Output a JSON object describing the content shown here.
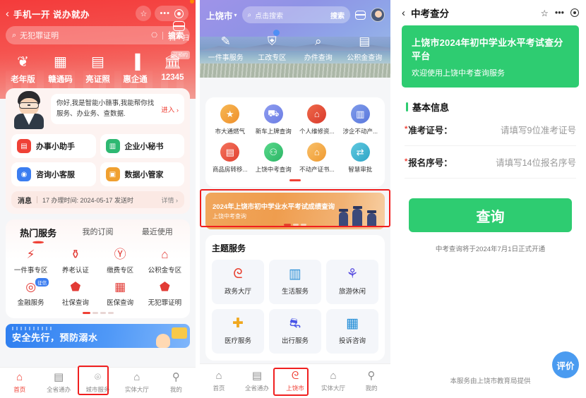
{
  "panel1": {
    "header": {
      "back_icon": "back-chevron-icon",
      "title": "手机一开 说办就办",
      "star_icon": "star-icon",
      "more_icon": "more-dots-icon",
      "target_icon": "target-icon",
      "scan_label": "扫一扫",
      "scan_icon": "scan-icon"
    },
    "search": {
      "icon": "search-icon",
      "placeholder": "无犯罪证明",
      "mic_icon": "microphone-icon",
      "button_label": "搜索"
    },
    "quick_items": [
      {
        "label": "老年版",
        "icon": "elder-heart-icon",
        "glyph": "♡",
        "badge": ""
      },
      {
        "label": "赣通码",
        "icon": "qr-grid-icon",
        "glyph": "▦",
        "badge": ""
      },
      {
        "label": "亮证照",
        "icon": "id-card-icon",
        "glyph": "▤",
        "badge": ""
      },
      {
        "label": "惠企通",
        "icon": "building-icon",
        "glyph": "🏢",
        "badge": ""
      },
      {
        "label": "12345",
        "icon": "bank-columns-icon",
        "glyph": "🏛",
        "badge": "可预约"
      }
    ],
    "assistant": {
      "avatar_icon": "assistant-avatar",
      "message": "你好,我是智能小赣事,我能帮你找服务、办业务、查数据.",
      "enter_label": "进入 ›",
      "items": [
        {
          "label": "办事小助手",
          "icon": "helper-icon",
          "color": "#ef4136",
          "glyph": "▤"
        },
        {
          "label": "企业小秘书",
          "icon": "enterprise-secretary-icon",
          "color": "#2eb872",
          "glyph": "▥"
        },
        {
          "label": "咨询小客服",
          "icon": "consult-service-icon",
          "color": "#3b7df0",
          "glyph": "◉"
        },
        {
          "label": "数据小管家",
          "icon": "data-steward-icon",
          "color": "#f0a030",
          "glyph": "▣"
        }
      ]
    },
    "message_bar": {
      "title": "消息",
      "content": "17 办理时间: 2024-05-17 发送时",
      "detail_label": "详情 ›"
    },
    "hot_card": {
      "tabs": [
        {
          "label": "热门服务",
          "active": true
        },
        {
          "label": "我的订阅",
          "active": false
        },
        {
          "label": "最近使用",
          "active": false
        }
      ],
      "items": [
        {
          "label": "一件事专区",
          "icon": "lightning-circle-icon",
          "glyph": "⚡",
          "badge": ""
        },
        {
          "label": "养老认证",
          "icon": "elder-person-icon",
          "glyph": "👤",
          "badge": ""
        },
        {
          "label": "缴费专区",
          "icon": "yuan-circle-icon",
          "glyph": "¥",
          "badge": ""
        },
        {
          "label": "公积金专区",
          "icon": "fund-house-icon",
          "glyph": "⌂",
          "badge": ""
        },
        {
          "label": "金融服务",
          "icon": "finance-circle-icon",
          "glyph": "◎",
          "badge": "征信"
        },
        {
          "label": "社保查询",
          "icon": "social-insurance-icon",
          "glyph": "SI",
          "badge": ""
        },
        {
          "label": "医保查询",
          "icon": "medical-insurance-icon",
          "glyph": "+",
          "badge": ""
        },
        {
          "label": "无犯罪证明",
          "icon": "no-crime-shield-icon",
          "glyph": "★",
          "badge": ""
        }
      ],
      "page_dots": 4,
      "active_dot": 0
    },
    "blue_banner": {
      "title": "安全先行，预防溺水"
    },
    "tabbar": [
      {
        "label": "首页",
        "icon": "home-icon",
        "glyph": "⌂",
        "active": true
      },
      {
        "label": "全省通办",
        "icon": "document-icon",
        "glyph": "▤",
        "active": false
      },
      {
        "label": "城市服务",
        "icon": "location-pin-icon",
        "glyph": "⌾",
        "active": false,
        "highlighted": true
      },
      {
        "label": "实体大厅",
        "icon": "hall-building-icon",
        "glyph": "⌂",
        "active": false
      },
      {
        "label": "我的",
        "icon": "person-icon",
        "glyph": "⚲",
        "active": false
      }
    ]
  },
  "panel2": {
    "header": {
      "city": "上饶市",
      "chevron_icon": "chevron-down-icon",
      "search_icon": "search-icon",
      "search_placeholder": "点击搜索",
      "search_button": "搜索",
      "scan_icon": "scan-icon",
      "avatar_icon": "user-avatar"
    },
    "quick_items": [
      {
        "label": "一件事服务",
        "icon": "pen-document-icon",
        "glyph": "✎",
        "dot": false
      },
      {
        "label": "工改专区",
        "icon": "construction-icon",
        "glyph": "⛨",
        "dot": true
      },
      {
        "label": "办件查询",
        "icon": "search-file-icon",
        "glyph": "⌕",
        "dot": false
      },
      {
        "label": "公积金查询",
        "icon": "fund-card-icon",
        "glyph": "▤",
        "dot": false
      }
    ],
    "service_grid": [
      {
        "label": "市大通燃气",
        "icon": "star-circle-icon",
        "glyph": "★",
        "color": "#f4a02c"
      },
      {
        "label": "新车上牌查询",
        "icon": "car-icon",
        "glyph": "🚗",
        "color": "#7b8ce8"
      },
      {
        "label": "个人维修资...",
        "icon": "house-repair-icon",
        "glyph": "⌂",
        "color": "#e8503a"
      },
      {
        "label": "涉企不动产...",
        "icon": "building-grid-icon",
        "glyph": "▥",
        "color": "#6c8ce0"
      },
      {
        "label": "商品房转移...",
        "icon": "transfer-doc-icon",
        "glyph": "▤",
        "color": "#ef5b4a"
      },
      {
        "label": "上饶中考查询",
        "icon": "person-list-icon",
        "glyph": "👥",
        "color": "#38c172"
      },
      {
        "label": "不动产证书...",
        "icon": "home-cert-icon",
        "glyph": "⌂",
        "color": "#f0a54a"
      },
      {
        "label": "智慧审批",
        "icon": "approval-flow-icon",
        "glyph": "⇄",
        "color": "#3fb9d6"
      }
    ],
    "ad_banner": {
      "title": "2024年上饶市初中学业水平考试成绩查询",
      "subtitle": "上饶中考查询",
      "dots": 3,
      "active_dot": 0
    },
    "theme": {
      "heading": "主题服务",
      "items": [
        {
          "label": "政务大厅",
          "icon": "gov-hall-icon",
          "glyph": "ᘓ",
          "color": "#e8402f"
        },
        {
          "label": "生活服务",
          "icon": "city-life-icon",
          "glyph": "🏙",
          "color": "#2b8fd6"
        },
        {
          "label": "旅游休闲",
          "icon": "travel-icon",
          "glyph": "✈",
          "color": "#5a4fe0"
        },
        {
          "label": "医疗服务",
          "icon": "medical-kit-icon",
          "glyph": "✚",
          "color": "#f0a81e"
        },
        {
          "label": "出行服务",
          "icon": "bus-icon",
          "glyph": "🚌",
          "color": "#4a56e8"
        },
        {
          "label": "投诉咨询",
          "icon": "office-building-icon",
          "glyph": "▦",
          "color": "#1b8ad6"
        }
      ]
    },
    "tabbar": [
      {
        "label": "首页",
        "icon": "home-icon",
        "glyph": "⌂",
        "active": false
      },
      {
        "label": "全省通办",
        "icon": "document-icon",
        "glyph": "▤",
        "active": false
      },
      {
        "label": "上饶市",
        "icon": "city-flame-icon",
        "glyph": "ᘓ",
        "active": true,
        "highlighted": true
      },
      {
        "label": "实体大厅",
        "icon": "hall-building-icon",
        "glyph": "⌂",
        "active": false
      },
      {
        "label": "我的",
        "icon": "person-icon",
        "glyph": "⚲",
        "active": false
      }
    ]
  },
  "panel3": {
    "header": {
      "back_icon": "back-chevron-icon",
      "title": "中考查分",
      "star_icon": "star-outline-icon",
      "more_icon": "more-dots-icon",
      "target_icon": "target-icon"
    },
    "banner": {
      "title": "上饶市2024年初中学业水平考试查分平台",
      "subtitle": "欢迎使用上饶中考查询服务",
      "color": "#2ecc71"
    },
    "section": {
      "heading": "基本信息"
    },
    "fields": [
      {
        "label": "准考证号：",
        "placeholder": "请填写9位准考证号",
        "required": true
      },
      {
        "label": "报名序号：",
        "placeholder": "请填写14位报名序号",
        "required": true
      }
    ],
    "query_button": {
      "label": "查询",
      "color": "#2ecc71"
    },
    "notice": "中考查询将于2024年7月1日正式开通",
    "footer": "本服务由上饶市教育局提供",
    "fab": {
      "label": "评价",
      "color": "#4a9bf0"
    }
  }
}
